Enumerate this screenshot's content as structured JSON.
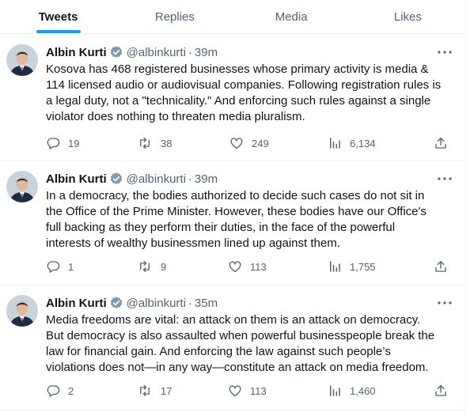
{
  "tabs": [
    {
      "label": "Tweets",
      "active": true
    },
    {
      "label": "Replies",
      "active": false
    },
    {
      "label": "Media",
      "active": false
    },
    {
      "label": "Likes",
      "active": false
    }
  ],
  "colors": {
    "accent": "#1d9bf0",
    "text": "#0f1419",
    "muted": "#536471",
    "border": "#eff3f4"
  },
  "tweets": [
    {
      "name": "Albin Kurti",
      "handle": "@albinkurti",
      "time": "39m",
      "text": "Kosova has 468 registered businesses whose primary activity is media &\n114 licensed audio or audiovisual companies. Following registration rules is\na legal duty, not a \"technicality.\" And enforcing such rules against a single\nviolator does nothing to threaten media pluralism.",
      "replies": "19",
      "retweets": "38",
      "likes": "249",
      "views": "6,134"
    },
    {
      "name": "Albin Kurti",
      "handle": "@albinkurti",
      "time": "39m",
      "text": "In a democracy, the bodies authorized to decide such cases do not sit in\nthe Office of the Prime Minister. However, these bodies have our Office's\nfull backing as they perform their duties, in the face of the powerful\ninterests of wealthy businessmen lined up against them.",
      "replies": "1",
      "retweets": "9",
      "likes": "113",
      "views": "1,755"
    },
    {
      "name": "Albin Kurti",
      "handle": "@albinkurti",
      "time": "35m",
      "text": "Media freedoms are vital: an attack on them is an attack on democracy.\nBut democracy is also assaulted when powerful businesspeople break the\nlaw for financial gain. And enforcing the law against such people’s\nviolations does not—in any way—constitute an attack on media freedom.",
      "replies": "2",
      "retweets": "17",
      "likes": "113",
      "views": "1,460"
    }
  ]
}
